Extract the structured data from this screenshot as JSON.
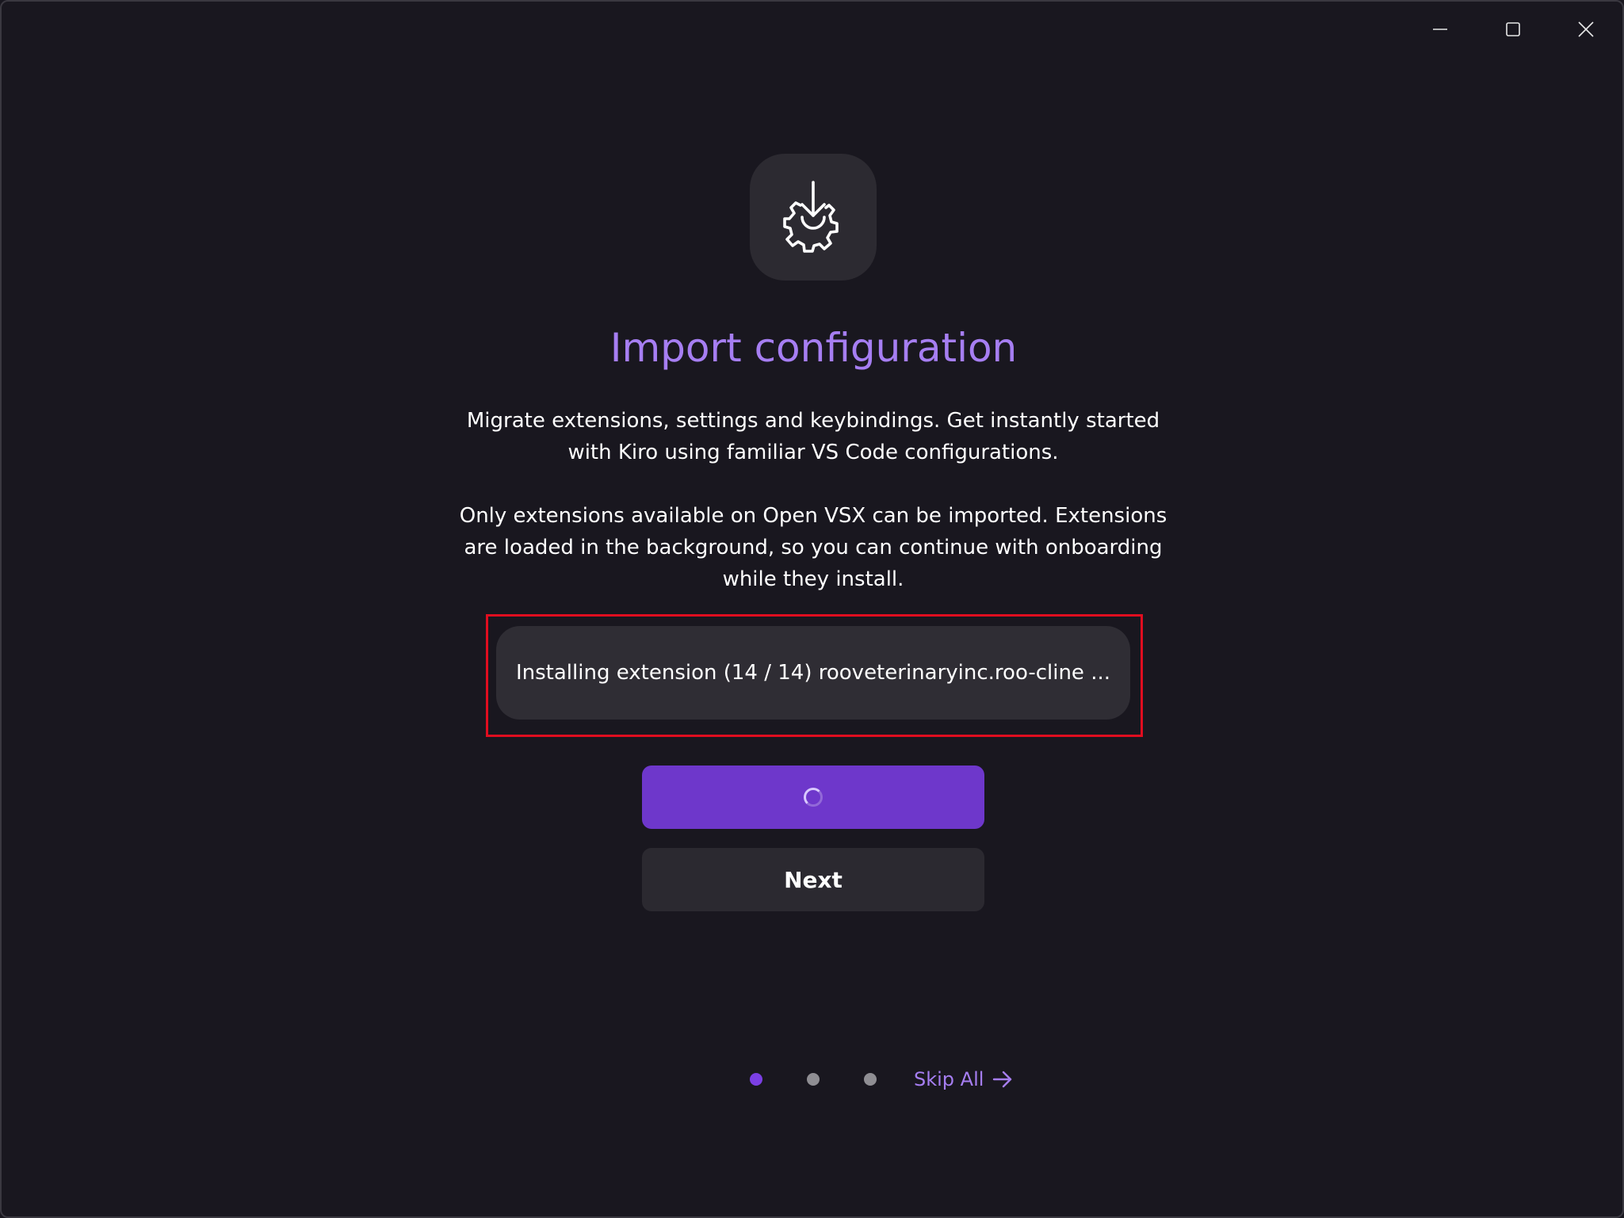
{
  "window": {
    "controls": [
      "minimize",
      "maximize",
      "close"
    ]
  },
  "header": {
    "icon": "import-settings-icon",
    "title": "Import configuration"
  },
  "description": {
    "paragraph_1": "Migrate extensions, settings and keybindings. Get instantly started with Kiro using familiar VS Code configurations.",
    "paragraph_2": "Only extensions available on Open VSX can be imported. Extensions are loaded in the background, so you can continue with onboarding while they install."
  },
  "status": {
    "text": "Installing extension (14 / 14) rooveterinaryinc.roo-cline ..."
  },
  "actions": {
    "primary_state": "loading",
    "next_label": "Next"
  },
  "pager": {
    "total_steps": 3,
    "active_step": 1,
    "skip_label": "Skip All"
  },
  "colors": {
    "background": "#19171f",
    "accent": "#a67ef2",
    "primary_button": "#6e37cb",
    "highlight_border": "#e00d1f"
  }
}
